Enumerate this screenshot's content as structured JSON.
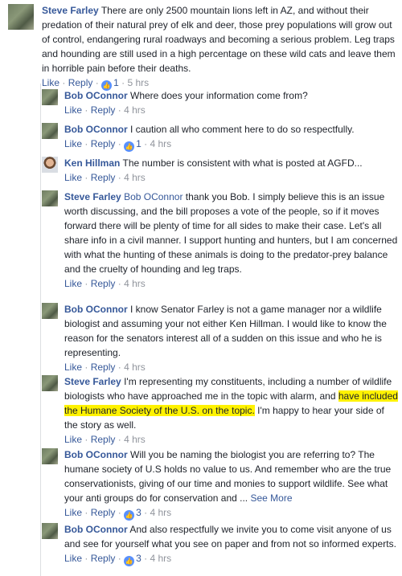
{
  "ui": {
    "like_label": "Like",
    "reply_label": "Reply",
    "separator": "·",
    "see_more_label": "See More"
  },
  "top_comment": {
    "author": "Steve Farley",
    "text": "There are only 2500 mountain lions left in AZ, and without their predation of their natural prey of elk and deer, those prey populations will grow out of control, endangering rural roadways and becoming a serious problem. Leg traps and hounding are still used in a high percentage on these wild cats and leave them in horrible pain before their deaths.",
    "reaction_count": "1",
    "time": "5 hrs"
  },
  "replies": [
    {
      "author": "Bob OConnor",
      "text": "Where does your information come from?",
      "time": "4 hrs"
    },
    {
      "author": "Bob OConnor",
      "text": "I caution all who comment here to do so respectfully.",
      "reaction_count": "1",
      "time": "4 hrs"
    },
    {
      "author": "Ken Hillman",
      "text": "The number is consistent with what is posted at AGFD...",
      "time": "4 hrs"
    },
    {
      "author": "Steve Farley",
      "mention": "Bob OConnor",
      "text": "thank you Bob. I simply believe this is an issue worth discussing, and the bill proposes a vote of the people, so if it moves forward there will be plenty of time for all sides to make their case. Let's all share info in a civil manner. I support hunting and hunters, but I am concerned with what the hunting of these animals is doing to the predator-prey balance and the cruelty of hounding and leg traps.",
      "time": "4 hrs"
    },
    {
      "author": "Bob OConnor",
      "text": "I know Senator Farley is not a game manager nor a wildlife biologist and assuming your not either Ken Hillman. I would like to know the reason for the senators interest all of a sudden on this issue and who he is representing.",
      "time": "4 hrs"
    },
    {
      "author": "Steve Farley",
      "text_before": "I'm representing my constituents, including a number of wildlife biologists who have approached me in the topic with alarm, and",
      "text_highlight": "have included the Humane Society of the U.S. on the topic.",
      "text_after": "I'm happy to hear your side of the story as well.",
      "time": "4 hrs"
    },
    {
      "author": "Bob OConnor",
      "text": "Will you be naming the biologist you are referring to? The humane society of U.S holds no value to us. And remember who are the true conservationists, giving of our time and monies to support wildlife. See what your anti groups do for conservation and ...",
      "reaction_count": "3",
      "time": "4 hrs"
    },
    {
      "author": "Bob OConnor",
      "text": "And also respectfully we invite you to come visit anyone of us and see for yourself what you see on paper and from not so informed experts.",
      "reaction_count": "3",
      "time": "4 hrs"
    }
  ],
  "colors": {
    "name": "#365899",
    "text": "#1d2129",
    "meta": "#90949c",
    "like_badge": "#5890ff",
    "highlight": "#fff200"
  },
  "icons": {
    "reaction": "thumbs-up-icon"
  }
}
